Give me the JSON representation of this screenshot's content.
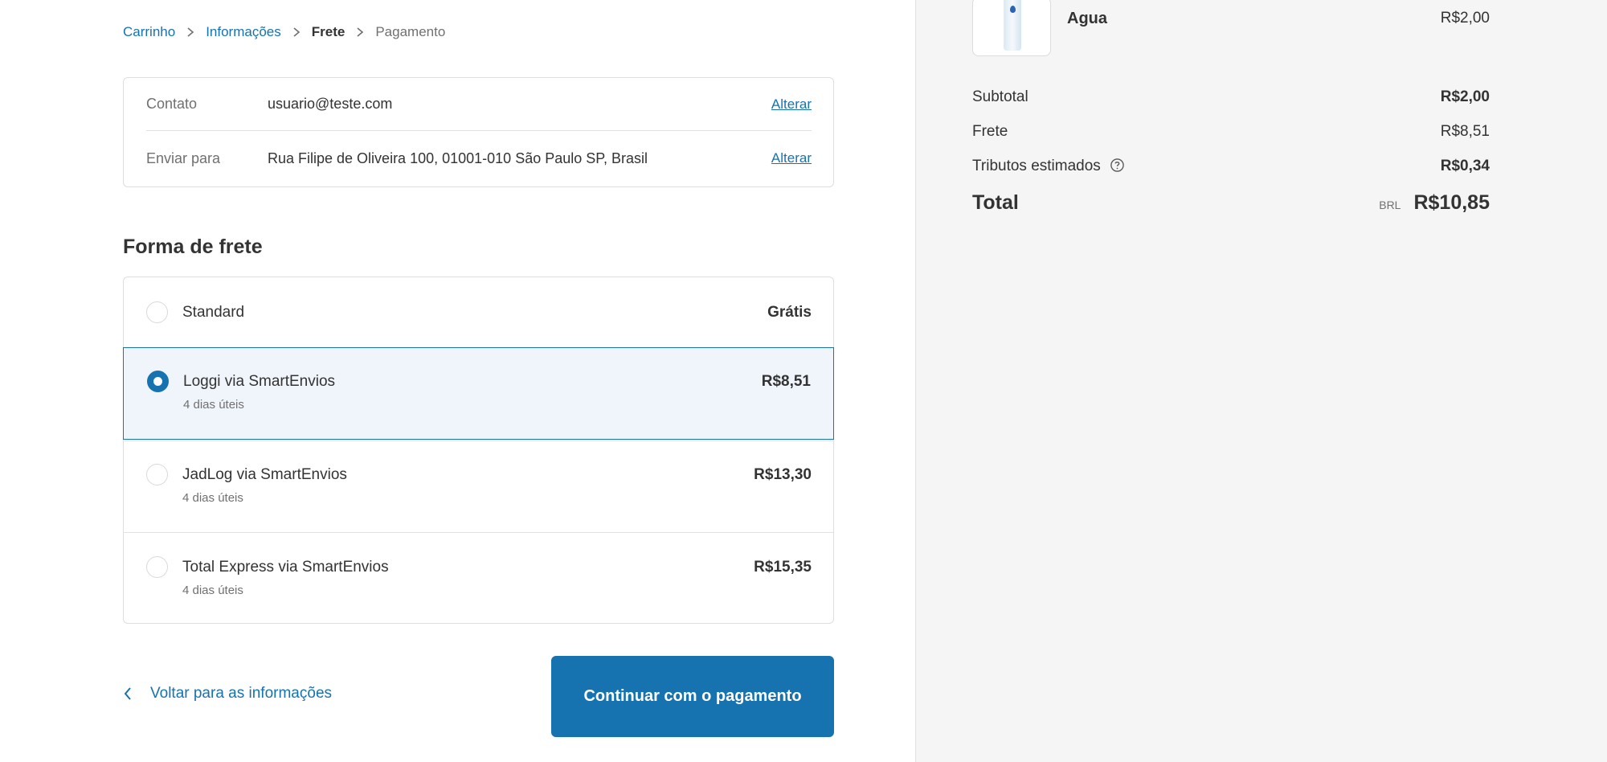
{
  "breadcrumb": {
    "items": [
      "Carrinho",
      "Informações",
      "Frete",
      "Pagamento"
    ]
  },
  "review": {
    "contact_label": "Contato",
    "contact_value": "usuario@teste.com",
    "ship_label": "Enviar para",
    "ship_value": "Rua Filipe de Oliveira 100, 01001-010 São Paulo SP, Brasil",
    "change_label": "Alterar"
  },
  "shipping": {
    "title": "Forma de frete",
    "options": [
      {
        "name": "Standard",
        "sub": "",
        "price": "Grátis",
        "selected": false
      },
      {
        "name": "Loggi via SmartEnvios",
        "sub": "4 dias úteis",
        "price": "R$8,51",
        "selected": true
      },
      {
        "name": "JadLog via SmartEnvios",
        "sub": "4 dias úteis",
        "price": "R$13,30",
        "selected": false
      },
      {
        "name": "Total Express via SmartEnvios",
        "sub": "4 dias úteis",
        "price": "R$15,35",
        "selected": false
      }
    ]
  },
  "actions": {
    "back_label": "Voltar para as informações",
    "continue_label": "Continuar com o pagamento"
  },
  "summary": {
    "product": {
      "name": "Agua",
      "price": "R$2,00"
    },
    "subtotal_label": "Subtotal",
    "subtotal_value": "R$2,00",
    "shipping_label": "Frete",
    "shipping_value": "R$8,51",
    "taxes_label": "Tributos estimados",
    "taxes_value": "R$0,34",
    "total_label": "Total",
    "currency": "BRL",
    "total_value": "R$10,85"
  },
  "colors": {
    "accent": "#1773b0",
    "selected_bg": "#f0f5fb",
    "summary_bg": "#f5f5f5"
  }
}
